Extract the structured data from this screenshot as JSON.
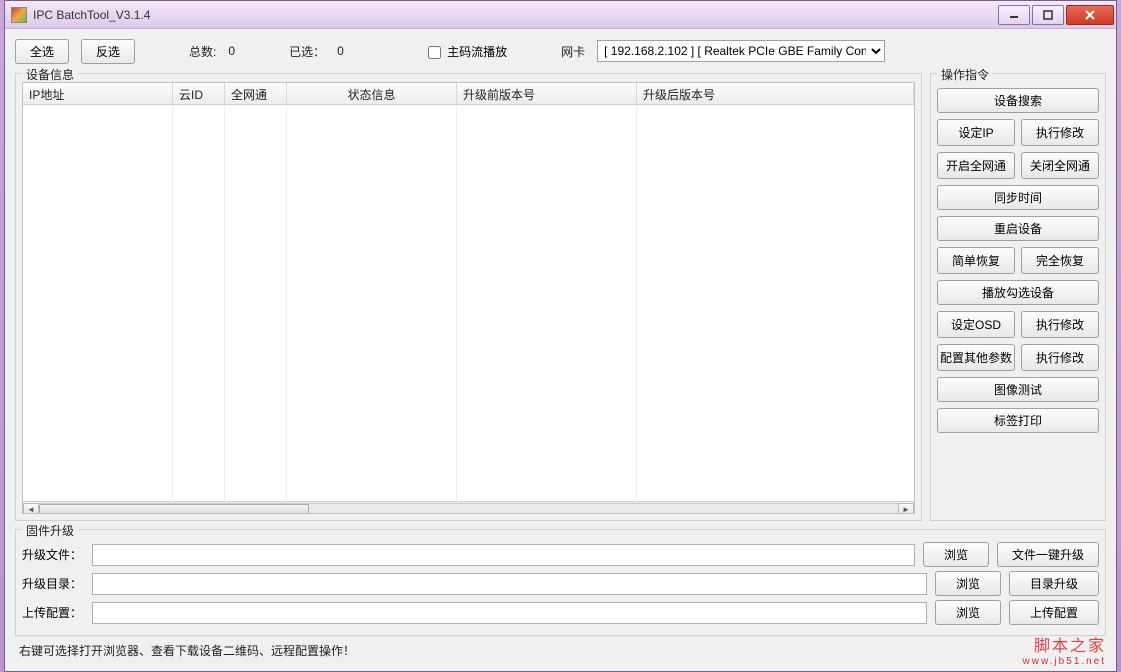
{
  "titlebar": {
    "title": "IPC BatchTool_V3.1.4"
  },
  "top": {
    "select_all": "全选",
    "invert_select": "反选",
    "total_label": "总数:",
    "total_value": "0",
    "selected_label": "已选：",
    "selected_value": "0",
    "mainstream_label": "主码流播放",
    "nic_label": "网卡",
    "nic_value": "[ 192.168.2.102 ] [ Realtek PCIe GBE Family Con"
  },
  "device_info": {
    "title": "设备信息",
    "columns": {
      "ip": "IP地址",
      "cloud_id": "云ID",
      "all_net": "全网通",
      "status": "状态信息",
      "pre_ver": "升级前版本号",
      "post_ver": "升级后版本号"
    }
  },
  "actions": {
    "title": "操作指令",
    "search": "设备搜索",
    "set_ip": "设定IP",
    "exec_mod1": "执行修改",
    "enable_allnet": "开启全网通",
    "disable_allnet": "关闭全网通",
    "sync_time": "同步时间",
    "reboot": "重启设备",
    "simple_restore": "简单恢复",
    "full_restore": "完全恢复",
    "play_selected": "播放勾选设备",
    "set_osd": "设定OSD",
    "exec_mod2": "执行修改",
    "config_other": "配置其他参数",
    "exec_mod3": "执行修改",
    "image_test": "图像测试",
    "label_print": "标签打印"
  },
  "firmware": {
    "title": "固件升级",
    "file_label": "升级文件：",
    "file_value": "",
    "browse": "浏览",
    "file_upgrade": "文件一键升级",
    "dir_label": "升级目录：",
    "dir_value": "",
    "dir_upgrade": "目录升级",
    "config_label": "上传配置：",
    "config_value": "",
    "upload_config": "上传配置"
  },
  "footer": {
    "hint": "右键可选择打开浏览器、查看下载设备二维码、远程配置操作！"
  },
  "watermark": {
    "zh": "脚本之家",
    "en": "www.jb51.net"
  }
}
